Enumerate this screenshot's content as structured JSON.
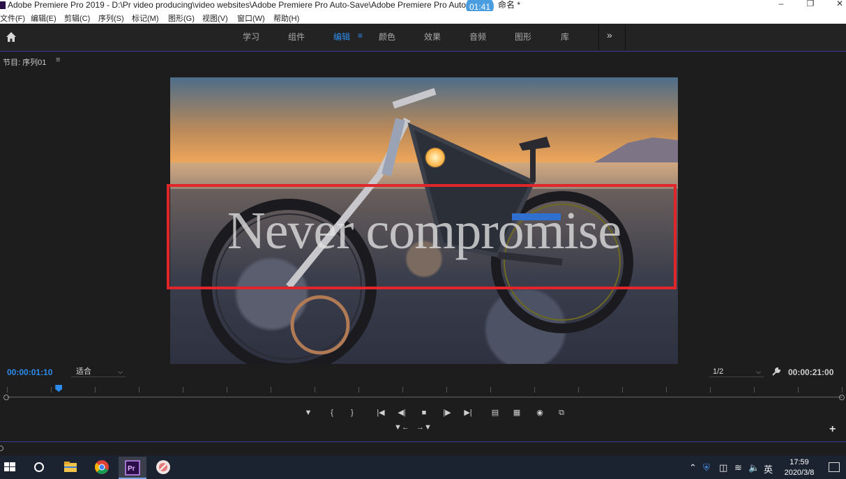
{
  "window": {
    "title": "Adobe Premiere Pro 2019 - D:\\Pr video producing\\video websites\\Adobe Premiere Pro Auto-Save\\Adobe Premiere Pro Auto",
    "title_suffix": "命名 *",
    "recording_timer": "01:41"
  },
  "menubar": [
    "文件(F)",
    "编辑(E)",
    "剪辑(C)",
    "序列(S)",
    "标记(M)",
    "图形(G)",
    "视图(V)",
    "窗口(W)",
    "帮助(H)"
  ],
  "workspaces": {
    "tabs": [
      "学习",
      "组件",
      "编辑",
      "颜色",
      "效果",
      "音频",
      "图形",
      "库"
    ],
    "active": "编辑",
    "more_glyph": "»"
  },
  "program_monitor": {
    "panel_title": "节目: 序列01",
    "overlay_text": "Never compromise",
    "timecode_current": "00:00:01:10",
    "zoom_select": "适合",
    "resolution_select": "1/2",
    "timecode_duration": "00:00:21:00",
    "playhead_position_fraction": 0.062
  },
  "taskbar": {
    "apps": [
      "start",
      "cortana",
      "file-explorer",
      "chrome",
      "premiere-pro",
      "media-player"
    ],
    "ime_label": "英",
    "time": "17:59",
    "date": "2020/3/8"
  },
  "colors": {
    "accent_blue": "#2d8ceb",
    "highlight_red": "#e0252b",
    "panel_bg": "#1d1d1d"
  }
}
